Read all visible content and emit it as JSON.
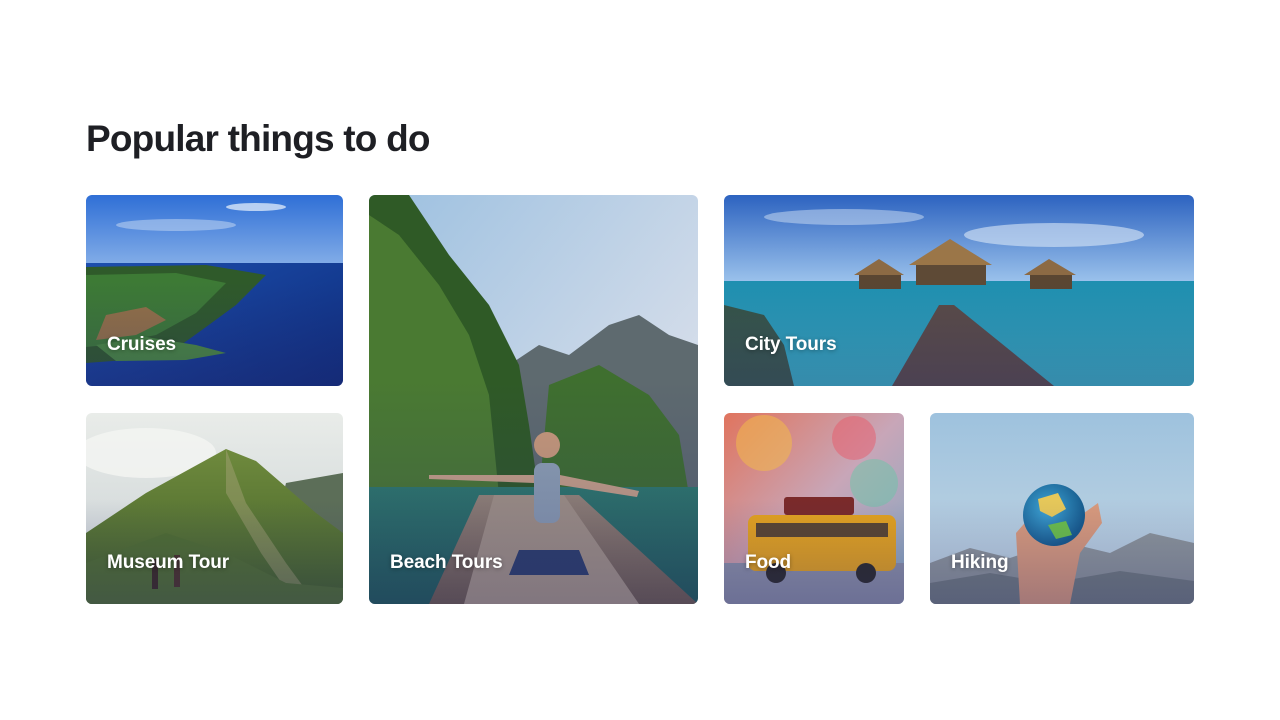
{
  "section": {
    "title": "Popular things to do"
  },
  "cards": {
    "cruises": {
      "label": "Cruises",
      "image": "coastal-island-aerial"
    },
    "museum_tour": {
      "label": "Museum Tour",
      "image": "green-mountain-hikers"
    },
    "beach_tours": {
      "label": "Beach Tours",
      "image": "woman-on-boat-cliffs"
    },
    "city_tours": {
      "label": "City Tours",
      "image": "overwater-bungalows-pier"
    },
    "food": {
      "label": "Food",
      "image": "yellow-toy-van"
    },
    "hiking": {
      "label": "Hiking",
      "image": "hand-holding-globe"
    }
  },
  "colors": {
    "title_text": "#1e1f24",
    "label_text": "#ffffff",
    "card_overlay": "#28286e"
  }
}
